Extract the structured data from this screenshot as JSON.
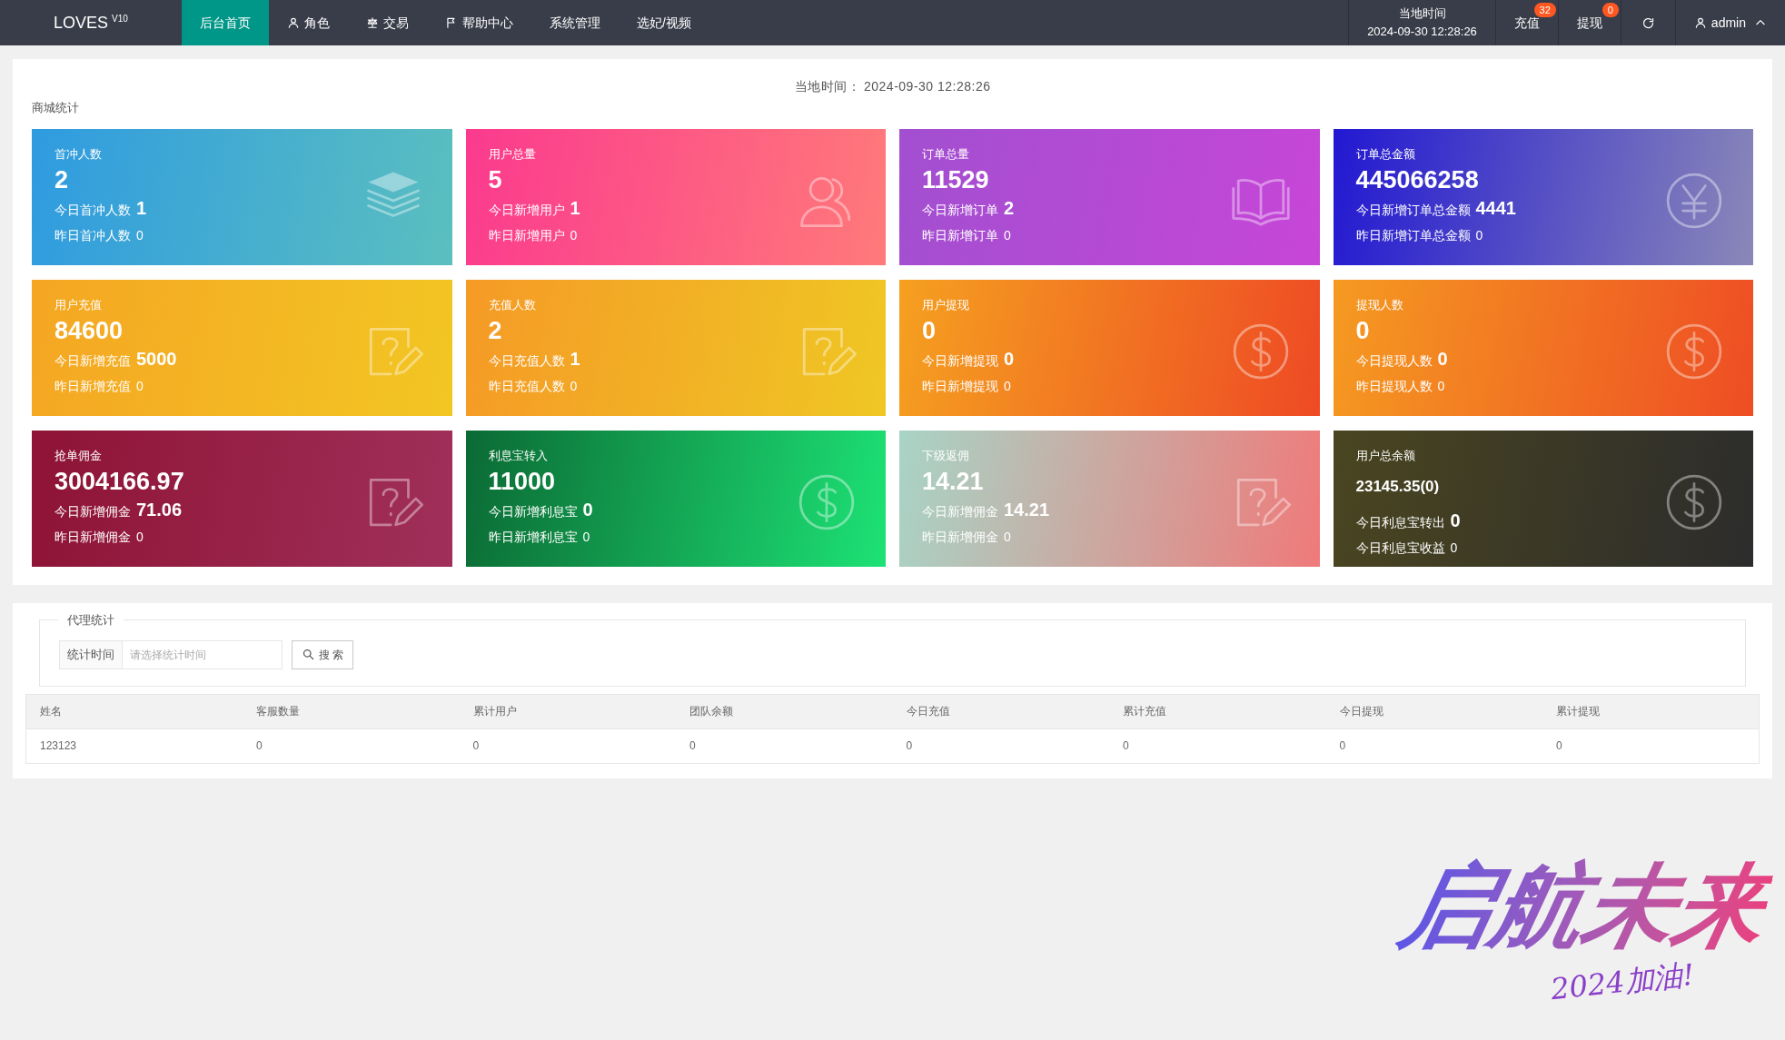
{
  "nav": {
    "logo": "LOVES",
    "version": "V10",
    "menu": [
      {
        "label": "后台首页",
        "selected": true
      },
      {
        "label": "角色",
        "selected": false
      },
      {
        "label": "交易",
        "selected": false
      },
      {
        "label": "帮助中心",
        "selected": false
      },
      {
        "label": "系统管理",
        "selected": false
      },
      {
        "label": "选妃/视频",
        "selected": false
      }
    ],
    "time_label": "当地时间",
    "time": "2024-09-30 12:28:26",
    "actions": [
      {
        "label": "充值",
        "badge": "32"
      },
      {
        "label": "提现",
        "badge": "0"
      }
    ],
    "user": "admin"
  },
  "stats": {
    "time_label": "当地时间：",
    "time": "2024-09-30 12:28:26",
    "title": "商城统计",
    "cards": [
      {
        "title": "首冲人数",
        "value": "2",
        "today_label": "今日首冲人数",
        "today": "1",
        "yesterday_label": "昨日首冲人数",
        "yesterday": "0",
        "color": "#2f9be0"
      },
      {
        "title": "用户总量",
        "value": "5",
        "today_label": "今日新增用户",
        "today": "1",
        "yesterday_label": "昨日新增用户",
        "yesterday": "0",
        "color": "#fb3a8e"
      },
      {
        "title": "订单总量",
        "value": "11529",
        "today_label": "今日新增订单",
        "today": "2",
        "yesterday_label": "昨日新增订单",
        "yesterday": "0",
        "color": "#a24fd0"
      },
      {
        "title": "订单总金额",
        "value": "445066258",
        "today_label": "今日新增订单总金额",
        "today": "4441",
        "yesterday_label": "昨日新增订单总金额",
        "yesterday": "0",
        "color": "#2218d2"
      },
      {
        "title": "用户充值",
        "value": "84600",
        "today_label": "今日新增充值",
        "today": "5000",
        "yesterday_label": "昨日新增充值",
        "yesterday": "0",
        "color": "#f5a623"
      },
      {
        "title": "充值人数",
        "value": "2",
        "today_label": "今日充值人数",
        "today": "1",
        "yesterday_label": "昨日充值人数",
        "yesterday": "0",
        "color": "#f59a26"
      },
      {
        "title": "用户提现",
        "value": "0",
        "today_label": "今日新增提现",
        "today": "0",
        "yesterday_label": "昨日新增提现",
        "yesterday": "0",
        "color": "#f5a020"
      },
      {
        "title": "提现人数",
        "value": "0",
        "today_label": "今日提现人数",
        "today": "0",
        "yesterday_label": "昨日提现人数",
        "yesterday": "0",
        "color": "#f59a21"
      },
      {
        "title": "抢单佣金",
        "value": "3004166.97",
        "today_label": "今日新增佣金",
        "today": "71.06",
        "yesterday_label": "昨日新增佣金",
        "yesterday": "0",
        "color": "#8e1335"
      },
      {
        "title": "利息宝转入",
        "value": "11000",
        "today_label": "今日新增利息宝",
        "today": "0",
        "yesterday_label": "昨日新增利息宝",
        "yesterday": "0",
        "color": "#0b6a34"
      },
      {
        "title": "下级返佣",
        "value": "14.21",
        "today_label": "今日新增佣金",
        "today": "14.21",
        "yesterday_label": "昨日新增佣金",
        "yesterday": "0",
        "color": "#a8d4c6"
      },
      {
        "title": "用户总余额",
        "value": "23145.35(0)",
        "today_label": "今日利息宝转出",
        "today": "0",
        "yesterday_label": "今日利息宝收益",
        "yesterday": "0",
        "color": "#4a4520"
      }
    ]
  },
  "agent": {
    "legend": "代理统计",
    "field_label": "统计时间",
    "placeholder": "请选择统计时间",
    "search_button": "搜 索",
    "columns": [
      "姓名",
      "客服数量",
      "累计用户",
      "团队余额",
      "今日充值",
      "累计充值",
      "今日提现",
      "累计提现"
    ],
    "rows": [
      [
        "123123",
        "0",
        "0",
        "0",
        "0",
        "0",
        "0",
        "0"
      ]
    ]
  },
  "banner": {
    "title": "启航未来",
    "subtitle": "2024加油!"
  }
}
